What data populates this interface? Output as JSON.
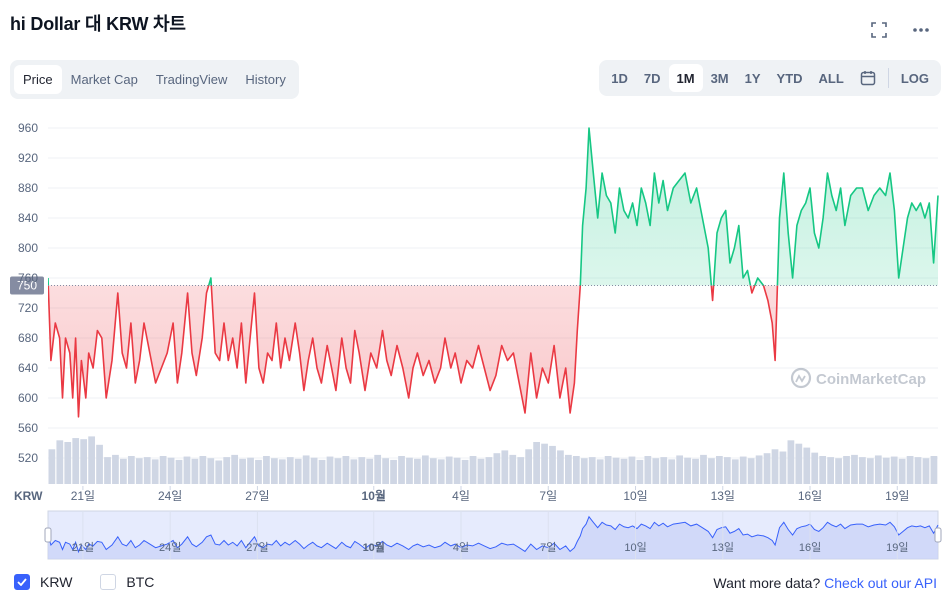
{
  "header": {
    "title": "hi Dollar 대 KRW 차트"
  },
  "tabs": [
    {
      "label": "Price",
      "active": true
    },
    {
      "label": "Market Cap",
      "active": false
    },
    {
      "label": "TradingView",
      "active": false
    },
    {
      "label": "History",
      "active": false
    }
  ],
  "ranges": [
    {
      "label": "1D",
      "active": false
    },
    {
      "label": "7D",
      "active": false
    },
    {
      "label": "1M",
      "active": true
    },
    {
      "label": "3M",
      "active": false
    },
    {
      "label": "1Y",
      "active": false
    },
    {
      "label": "YTD",
      "active": false
    },
    {
      "label": "ALL",
      "active": false
    }
  ],
  "log_label": "LOG",
  "icons": {
    "fullscreen": "fullscreen-icon",
    "more": "more-icon",
    "calendar": "calendar-icon",
    "check": "check-icon",
    "logo": "coinmarketcap-logo-icon"
  },
  "colors": {
    "up": "#16c784",
    "down": "#ea3943",
    "accent": "#3861fb",
    "volume": "#cfd6e4"
  },
  "chart_data": {
    "type": "line",
    "ylim": [
      540,
      970
    ],
    "yticks": [
      520,
      560,
      600,
      640,
      680,
      720,
      760,
      800,
      840,
      880,
      920,
      960
    ],
    "baseline": 750,
    "baseline_label": "750",
    "unit_label": "KRW",
    "xticks": [
      {
        "label": "21일",
        "t": 1.2,
        "bold": false
      },
      {
        "label": "24일",
        "t": 4.2,
        "bold": false
      },
      {
        "label": "27일",
        "t": 7.2,
        "bold": false
      },
      {
        "label": "10월",
        "t": 11.2,
        "bold": true
      },
      {
        "label": "4일",
        "t": 14.2,
        "bold": false
      },
      {
        "label": "7일",
        "t": 17.2,
        "bold": false
      },
      {
        "label": "10일",
        "t": 20.2,
        "bold": false
      },
      {
        "label": "13일",
        "t": 23.2,
        "bold": false
      },
      {
        "label": "16일",
        "t": 26.2,
        "bold": false
      },
      {
        "label": "19일",
        "t": 29.2,
        "bold": false
      }
    ],
    "t_range": [
      0,
      30.6
    ],
    "series": [
      {
        "points": [
          [
            0.0,
            760
          ],
          [
            0.1,
            650
          ],
          [
            0.25,
            700
          ],
          [
            0.4,
            680
          ],
          [
            0.5,
            600
          ],
          [
            0.6,
            680
          ],
          [
            0.75,
            660
          ],
          [
            0.85,
            600
          ],
          [
            0.95,
            680
          ],
          [
            1.05,
            575
          ],
          [
            1.15,
            650
          ],
          [
            1.3,
            600
          ],
          [
            1.4,
            660
          ],
          [
            1.55,
            640
          ],
          [
            1.7,
            690
          ],
          [
            1.85,
            680
          ],
          [
            2.0,
            600
          ],
          [
            2.2,
            650
          ],
          [
            2.4,
            740
          ],
          [
            2.55,
            660
          ],
          [
            2.7,
            640
          ],
          [
            2.85,
            700
          ],
          [
            3.0,
            620
          ],
          [
            3.15,
            650
          ],
          [
            3.3,
            700
          ],
          [
            3.5,
            660
          ],
          [
            3.7,
            620
          ],
          [
            3.9,
            640
          ],
          [
            4.1,
            660
          ],
          [
            4.3,
            700
          ],
          [
            4.45,
            620
          ],
          [
            4.6,
            660
          ],
          [
            4.8,
            740
          ],
          [
            4.95,
            660
          ],
          [
            5.1,
            630
          ],
          [
            5.3,
            680
          ],
          [
            5.45,
            740
          ],
          [
            5.6,
            760
          ],
          [
            5.75,
            660
          ],
          [
            5.9,
            650
          ],
          [
            6.05,
            700
          ],
          [
            6.2,
            650
          ],
          [
            6.35,
            680
          ],
          [
            6.5,
            640
          ],
          [
            6.65,
            700
          ],
          [
            6.8,
            620
          ],
          [
            6.95,
            680
          ],
          [
            7.1,
            740
          ],
          [
            7.25,
            640
          ],
          [
            7.4,
            620
          ],
          [
            7.55,
            660
          ],
          [
            7.7,
            650
          ],
          [
            7.85,
            700
          ],
          [
            8.0,
            640
          ],
          [
            8.15,
            680
          ],
          [
            8.3,
            650
          ],
          [
            8.5,
            700
          ],
          [
            8.65,
            660
          ],
          [
            8.8,
            610
          ],
          [
            8.95,
            650
          ],
          [
            9.1,
            680
          ],
          [
            9.25,
            640
          ],
          [
            9.4,
            620
          ],
          [
            9.6,
            670
          ],
          [
            9.75,
            640
          ],
          [
            9.9,
            610
          ],
          [
            10.1,
            680
          ],
          [
            10.25,
            640
          ],
          [
            10.4,
            620
          ],
          [
            10.55,
            690
          ],
          [
            10.7,
            660
          ],
          [
            10.9,
            610
          ],
          [
            11.1,
            660
          ],
          [
            11.3,
            640
          ],
          [
            11.5,
            690
          ],
          [
            11.65,
            650
          ],
          [
            11.8,
            630
          ],
          [
            12.0,
            670
          ],
          [
            12.2,
            640
          ],
          [
            12.4,
            600
          ],
          [
            12.55,
            640
          ],
          [
            12.7,
            660
          ],
          [
            12.9,
            630
          ],
          [
            13.1,
            650
          ],
          [
            13.3,
            620
          ],
          [
            13.5,
            640
          ],
          [
            13.65,
            680
          ],
          [
            13.85,
            640
          ],
          [
            14.0,
            660
          ],
          [
            14.2,
            620
          ],
          [
            14.4,
            650
          ],
          [
            14.6,
            640
          ],
          [
            14.8,
            670
          ],
          [
            15.0,
            640
          ],
          [
            15.2,
            610
          ],
          [
            15.4,
            630
          ],
          [
            15.6,
            670
          ],
          [
            15.8,
            650
          ],
          [
            16.0,
            660
          ],
          [
            16.2,
            620
          ],
          [
            16.4,
            580
          ],
          [
            16.6,
            660
          ],
          [
            16.8,
            600
          ],
          [
            17.0,
            640
          ],
          [
            17.2,
            620
          ],
          [
            17.4,
            670
          ],
          [
            17.6,
            600
          ],
          [
            17.8,
            640
          ],
          [
            17.95,
            580
          ],
          [
            18.1,
            620
          ],
          [
            18.2,
            690
          ],
          [
            18.3,
            750
          ],
          [
            18.38,
            830
          ],
          [
            18.5,
            880
          ],
          [
            18.6,
            960
          ],
          [
            18.75,
            900
          ],
          [
            18.9,
            840
          ],
          [
            19.05,
            900
          ],
          [
            19.2,
            870
          ],
          [
            19.35,
            860
          ],
          [
            19.5,
            820
          ],
          [
            19.65,
            880
          ],
          [
            19.8,
            850
          ],
          [
            19.95,
            840
          ],
          [
            20.1,
            860
          ],
          [
            20.25,
            830
          ],
          [
            20.4,
            880
          ],
          [
            20.55,
            860
          ],
          [
            20.7,
            830
          ],
          [
            20.85,
            900
          ],
          [
            21.0,
            860
          ],
          [
            21.15,
            890
          ],
          [
            21.3,
            850
          ],
          [
            21.5,
            880
          ],
          [
            21.7,
            890
          ],
          [
            21.9,
            900
          ],
          [
            22.1,
            860
          ],
          [
            22.3,
            880
          ],
          [
            22.5,
            840
          ],
          [
            22.7,
            800
          ],
          [
            22.85,
            730
          ],
          [
            23.0,
            820
          ],
          [
            23.15,
            840
          ],
          [
            23.3,
            850
          ],
          [
            23.45,
            780
          ],
          [
            23.6,
            800
          ],
          [
            23.75,
            830
          ],
          [
            23.9,
            760
          ],
          [
            24.05,
            770
          ],
          [
            24.2,
            740
          ],
          [
            24.4,
            760
          ],
          [
            24.6,
            750
          ],
          [
            24.75,
            730
          ],
          [
            24.9,
            700
          ],
          [
            25.0,
            650
          ],
          [
            25.15,
            840
          ],
          [
            25.3,
            900
          ],
          [
            25.45,
            820
          ],
          [
            25.6,
            760
          ],
          [
            25.75,
            830
          ],
          [
            25.9,
            850
          ],
          [
            26.05,
            860
          ],
          [
            26.2,
            880
          ],
          [
            26.35,
            820
          ],
          [
            26.5,
            800
          ],
          [
            26.65,
            840
          ],
          [
            26.8,
            900
          ],
          [
            26.95,
            870
          ],
          [
            27.1,
            850
          ],
          [
            27.25,
            880
          ],
          [
            27.4,
            830
          ],
          [
            27.6,
            870
          ],
          [
            27.8,
            880
          ],
          [
            28.0,
            880
          ],
          [
            28.2,
            850
          ],
          [
            28.4,
            870
          ],
          [
            28.6,
            880
          ],
          [
            28.8,
            870
          ],
          [
            28.95,
            900
          ],
          [
            29.1,
            850
          ],
          [
            29.25,
            760
          ],
          [
            29.4,
            800
          ],
          [
            29.55,
            840
          ],
          [
            29.7,
            860
          ],
          [
            29.85,
            850
          ],
          [
            30.0,
            860
          ],
          [
            30.15,
            840
          ],
          [
            30.3,
            860
          ],
          [
            30.45,
            780
          ],
          [
            30.6,
            870
          ]
        ]
      }
    ],
    "volume_ylim": [
      0,
      1
    ],
    "volume": [
      0.62,
      0.78,
      0.75,
      0.82,
      0.8,
      0.85,
      0.7,
      0.48,
      0.52,
      0.45,
      0.5,
      0.46,
      0.48,
      0.44,
      0.5,
      0.47,
      0.43,
      0.49,
      0.45,
      0.5,
      0.46,
      0.42,
      0.48,
      0.52,
      0.45,
      0.47,
      0.43,
      0.5,
      0.46,
      0.44,
      0.48,
      0.45,
      0.51,
      0.47,
      0.43,
      0.49,
      0.46,
      0.5,
      0.44,
      0.48,
      0.45,
      0.52,
      0.46,
      0.43,
      0.5,
      0.47,
      0.45,
      0.51,
      0.46,
      0.44,
      0.49,
      0.47,
      0.43,
      0.5,
      0.45,
      0.48,
      0.55,
      0.6,
      0.52,
      0.48,
      0.62,
      0.75,
      0.72,
      0.68,
      0.6,
      0.52,
      0.5,
      0.46,
      0.48,
      0.44,
      0.5,
      0.47,
      0.45,
      0.49,
      0.43,
      0.5,
      0.46,
      0.48,
      0.44,
      0.51,
      0.47,
      0.45,
      0.52,
      0.46,
      0.5,
      0.48,
      0.44,
      0.49,
      0.46,
      0.51,
      0.55,
      0.62,
      0.58,
      0.78,
      0.72,
      0.65,
      0.56,
      0.5,
      0.48,
      0.46,
      0.5,
      0.52,
      0.48,
      0.46,
      0.51,
      0.47,
      0.49,
      0.45,
      0.5,
      0.48,
      0.46,
      0.5
    ],
    "watermark": "CoinMarketCap"
  },
  "legend": [
    {
      "label": "KRW",
      "checked": true
    },
    {
      "label": "BTC",
      "checked": false
    }
  ],
  "footer": {
    "text": "Want more data?",
    "link": "Check out our API"
  }
}
